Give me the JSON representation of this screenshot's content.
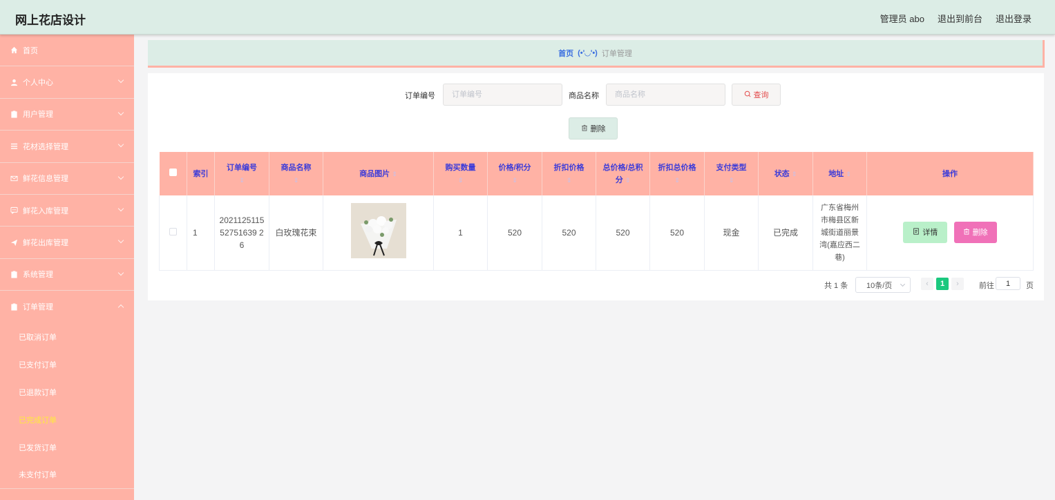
{
  "header": {
    "brand": "网上花店设计",
    "admin": "管理员 abo",
    "to_front": "退出到前台",
    "logout": "退出登录"
  },
  "sidebar": {
    "items": [
      {
        "label": "首页",
        "icon": "home-icon"
      },
      {
        "label": "个人中心",
        "icon": "user-icon"
      },
      {
        "label": "用户管理",
        "icon": "clipboard-icon"
      },
      {
        "label": "花材选择管理",
        "icon": "list-icon"
      },
      {
        "label": "鲜花信息管理",
        "icon": "mail-icon"
      },
      {
        "label": "鲜花入库管理",
        "icon": "chat-icon"
      },
      {
        "label": "鲜花出库管理",
        "icon": "send-icon"
      },
      {
        "label": "系统管理",
        "icon": "clipboard-icon"
      },
      {
        "label": "订单管理",
        "icon": "clipboard-icon"
      }
    ],
    "order_sub": [
      "已取消订单",
      "已支付订单",
      "已退款订单",
      "已完成订单",
      "已发货订单",
      "未支付订单"
    ]
  },
  "breadcrumb": {
    "home": "首页",
    "sep": "(•'◡'•)",
    "current": "订单管理"
  },
  "search": {
    "order_no_label": "订单编号",
    "order_no_placeholder": "订单编号",
    "product_label": "商品名称",
    "product_placeholder": "商品名称",
    "query_label": "查询",
    "delete_label": "删除"
  },
  "table": {
    "headers": [
      "索引",
      "订单编号",
      "商品名称",
      "商品图片",
      "购买数量",
      "价格/积分",
      "折扣价格",
      "总价格/总积分",
      "折扣总价格",
      "支付类型",
      "状态",
      "地址",
      "操作"
    ],
    "row": {
      "index": "1",
      "order_no": "202112511552751639 26",
      "product": "白玫瑰花束",
      "qty": "1",
      "price": "520",
      "discount_price": "520",
      "total": "520",
      "discount_total": "520",
      "pay_type": "现金",
      "status": "已完成",
      "address": "广东省梅州市梅县区新城街道丽景湾(嘉应西二巷)",
      "detail_label": "详情",
      "delete_label": "删除"
    }
  },
  "pagination": {
    "total": "共 1 条",
    "page_size": "10条/页",
    "current_page": "1",
    "goto_label": "前往",
    "goto_value": "1",
    "page_label": "页"
  },
  "colors": {
    "sidebar": "#ffb2a5",
    "header": "#dcede6",
    "accent_blue": "#3b3bd9",
    "active_page": "#1bc87e"
  }
}
